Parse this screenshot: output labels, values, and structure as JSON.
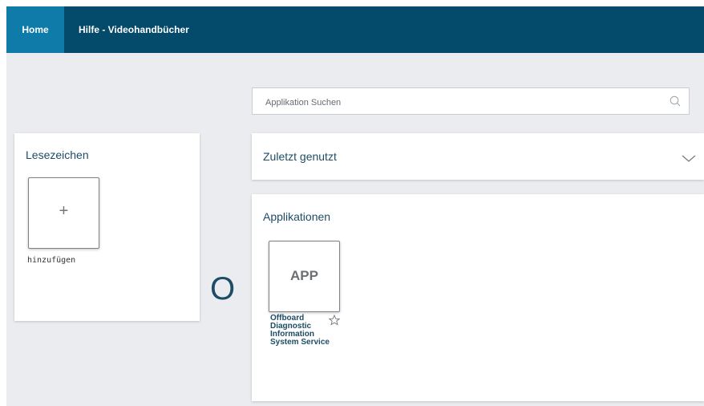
{
  "nav": {
    "home": "Home",
    "help": "Hilfe - Videohandbücher"
  },
  "search": {
    "placeholder": "Applikation Suchen",
    "icon": "search-icon"
  },
  "bookmarks": {
    "title": "Lesezeichen",
    "add_symbol": "+",
    "add_label": "hinzufügen"
  },
  "recent": {
    "title": "Zuletzt genutzt",
    "icon": "chevron-down-icon"
  },
  "applications": {
    "title": "Applikationen",
    "items": [
      {
        "tile_text": "APP",
        "name": "Offboard Diagnostic Information System Service",
        "favorite_icon": "star-outline-icon"
      }
    ]
  },
  "loader_text": "O",
  "colors": {
    "topbar": "#044a6b",
    "active_tab": "#0e7ba9",
    "background": "#eaecef",
    "title_text": "#1d4d66"
  }
}
